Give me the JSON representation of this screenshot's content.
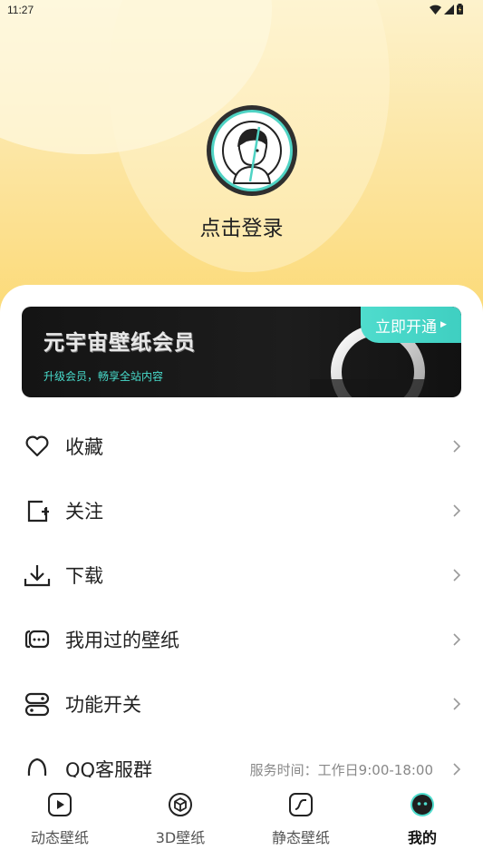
{
  "status_bar": {
    "time": "11:27"
  },
  "profile": {
    "login_text": "点击登录"
  },
  "vip_banner": {
    "title": "元宇宙壁纸会员",
    "subtitle": "升级会员，畅享全站内容",
    "button_label": "立即开通"
  },
  "menu": {
    "items": [
      {
        "label": "收藏",
        "icon": "heart-icon",
        "extra": ""
      },
      {
        "label": "关注",
        "icon": "follow-icon",
        "extra": ""
      },
      {
        "label": "下载",
        "icon": "download-icon",
        "extra": ""
      },
      {
        "label": "我用过的壁纸",
        "icon": "used-wallpaper-icon",
        "extra": ""
      },
      {
        "label": "功能开关",
        "icon": "toggle-icon",
        "extra": ""
      },
      {
        "label": "QQ客服群",
        "icon": "qq-icon",
        "extra": "服务时间：工作日9:00-18:00"
      }
    ]
  },
  "tabbar": {
    "tabs": [
      {
        "label": "动态壁纸",
        "icon": "play-square-icon",
        "active": false
      },
      {
        "label": "3D壁纸",
        "icon": "cube-icon",
        "active": false
      },
      {
        "label": "静态壁纸",
        "icon": "image-curve-icon",
        "active": false
      },
      {
        "label": "我的",
        "icon": "smiley-face-icon",
        "active": true
      }
    ]
  },
  "colors": {
    "accent": "#4fdccd",
    "header_gradient": "#fbd86f"
  }
}
